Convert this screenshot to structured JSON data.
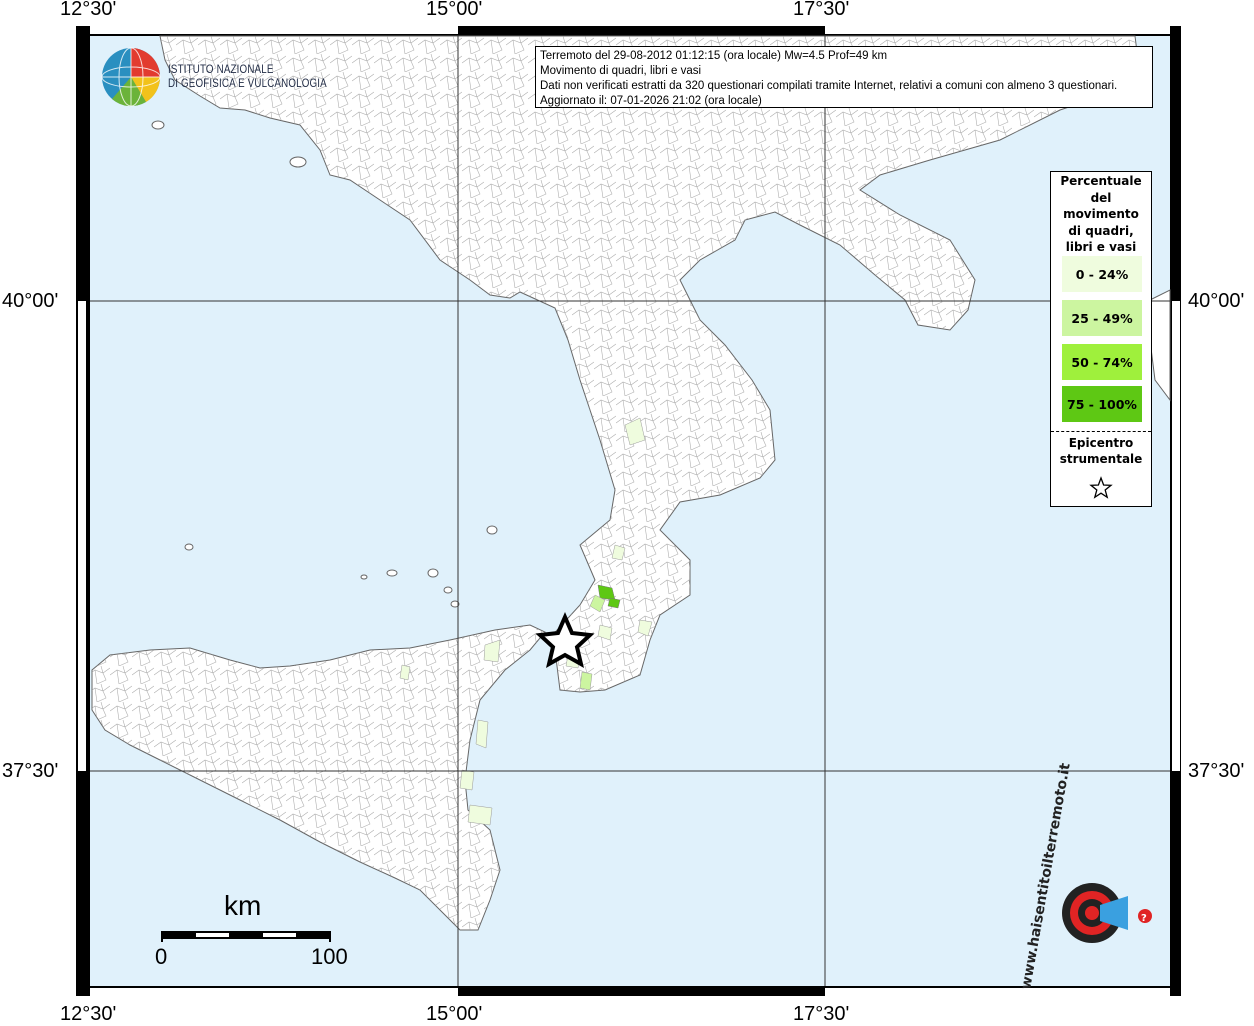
{
  "map": {
    "lon_labels": [
      "12°30'",
      "15°00'",
      "17°30'"
    ],
    "lat_labels": [
      "40°00'",
      "37°30'"
    ],
    "sea_color": "#e0f1fb",
    "land_color": "#ffffff",
    "border_color": "#9a9a9a"
  },
  "info": {
    "line1": "Terremoto del 29-08-2012 01:12:15 (ora locale) Mw=4.5 Prof=49 km",
    "line2": "Movimento di quadri, libri e vasi",
    "line3": "Dati non verificati estratti da 320 questionari compilati tramite Internet, relativi a comuni con almeno 3 questionari.",
    "line4": "Aggiornato il: 07-01-2026 21:02 (ora locale)"
  },
  "logo": {
    "line1": "ISTITUTO NAZIONALE",
    "line2": "DI GEOFISICA E VULCANOLOGIA"
  },
  "legend": {
    "title_lines": [
      "Percentuale",
      "del",
      "movimento",
      "di quadri,",
      "libri e vasi"
    ],
    "classes": [
      {
        "label": "0 - 24%",
        "color": "#effcde"
      },
      {
        "label": "25 - 49%",
        "color": "#ccf5a0"
      },
      {
        "label": "50 - 74%",
        "color": "#9ff03c"
      },
      {
        "label": "75 - 100%",
        "color": "#5ec814"
      }
    ],
    "epicenter_lines": [
      "Epicentro",
      "strumentale"
    ],
    "epicenter_icon": "star-outline-icon"
  },
  "scale": {
    "unit": "km",
    "min": "0",
    "max": "100"
  },
  "brand": {
    "text": "www.haisentitoilterremoto.it",
    "icon": "megaphone-icon"
  },
  "epicenter": {
    "icon": "star-outline-icon"
  }
}
